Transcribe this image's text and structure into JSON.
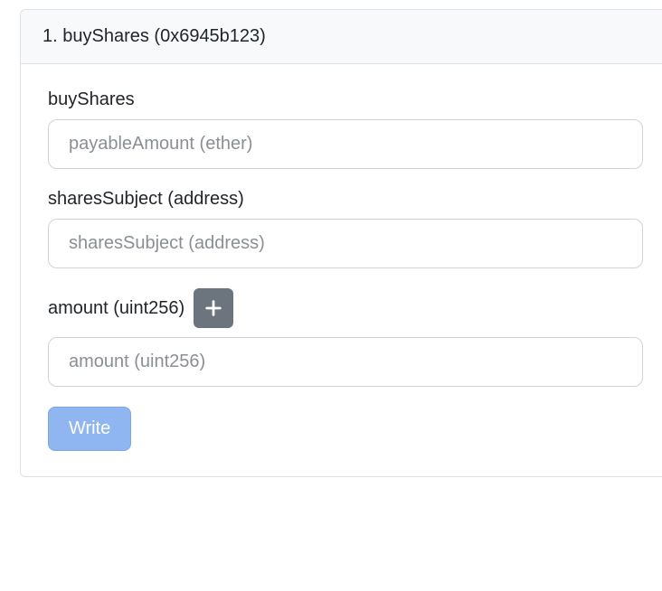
{
  "panel": {
    "header": "1. buyShares (0x6945b123)",
    "function_name": "buyShares",
    "fields": {
      "payable": {
        "label": "buyShares",
        "placeholder": "payableAmount (ether)",
        "value": ""
      },
      "sharesSubject": {
        "label": "sharesSubject (address)",
        "placeholder": "sharesSubject (address)",
        "value": ""
      },
      "amount": {
        "label": "amount (uint256)",
        "placeholder": "amount (uint256)",
        "value": ""
      }
    },
    "write_label": "Write"
  }
}
